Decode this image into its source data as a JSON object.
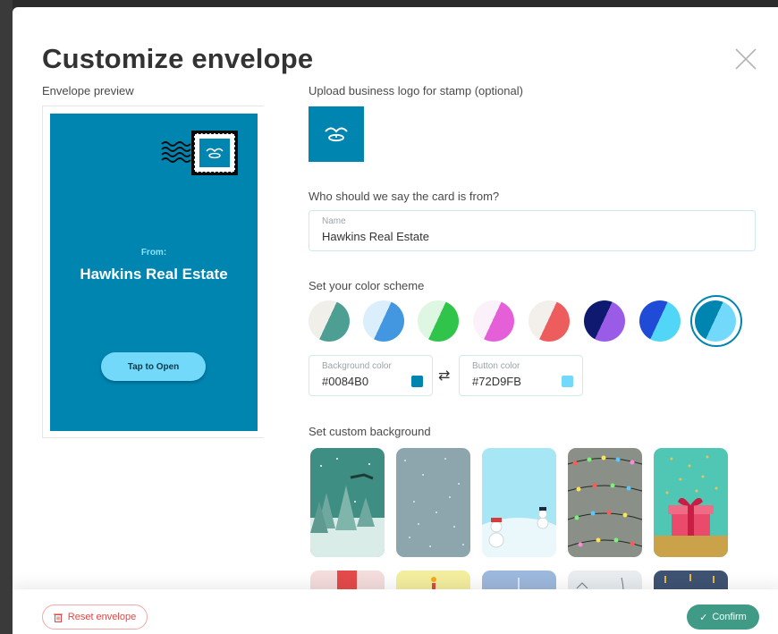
{
  "title": "Customize envelope",
  "preview": {
    "label": "Envelope preview",
    "from_label": "From:",
    "from_name": "Hawkins Real Estate",
    "open_button": "Tap to Open"
  },
  "logo": {
    "label": "Upload business logo for stamp (optional)"
  },
  "sender": {
    "label": "Who should we say the card is from?",
    "name_hint": "Name",
    "name_value": "Hawkins Real Estate"
  },
  "colors": {
    "label": "Set your color scheme",
    "schemes": [
      {
        "a": "#f1efe9",
        "b": "#4e9f93"
      },
      {
        "a": "#dbeefb",
        "b": "#4297e0"
      },
      {
        "a": "#ddf7e2",
        "b": "#30c44a"
      },
      {
        "a": "#fbf1fb",
        "b": "#e55fd9"
      },
      {
        "a": "#f3efea",
        "b": "#ee5d5d"
      },
      {
        "a": "#0d1a70",
        "b": "#9a5ce6"
      },
      {
        "a": "#1f4bd6",
        "b": "#52d6f7"
      },
      {
        "a": "#0084B0",
        "b": "#72D9FB"
      }
    ],
    "background_hint": "Background color",
    "background_value": "#0084B0",
    "button_hint": "Button color",
    "button_value": "#72D9FB"
  },
  "backgrounds": {
    "label": "Set custom background"
  },
  "footer": {
    "reset_label": "Reset envelope",
    "confirm_label": "Confirm"
  }
}
